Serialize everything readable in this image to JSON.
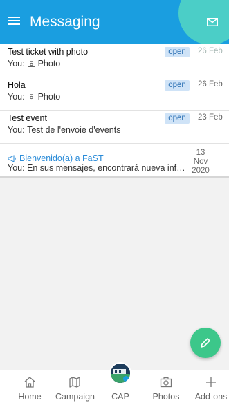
{
  "header": {
    "title": "Messaging"
  },
  "messages": [
    {
      "subject": "Test ticket with photo",
      "preview_prefix": "You:",
      "preview_text": "Photo",
      "status": "open",
      "date": "26 Feb"
    },
    {
      "subject": "Hola",
      "preview_prefix": "You:",
      "preview_text": "Photo",
      "status": "open",
      "date": "26 Feb"
    },
    {
      "subject": "Test event",
      "preview_prefix": "You:",
      "preview_text": "Test de l'envoie d'events",
      "status": "open",
      "date": "23 Feb"
    }
  ],
  "announcement": {
    "subject": "Bienvenido(a) a FaST",
    "preview": "You: En sus mensajes, encontrará nueva información",
    "date_line1": "13 Nov",
    "date_line2": "2020"
  },
  "nav": {
    "home": "Home",
    "campaign": "Campaign",
    "cap": "CAP",
    "photos": "Photos",
    "addons": "Add-ons"
  },
  "colors": {
    "header": "#1a9ee0",
    "accent": "#4fd3c4",
    "fab": "#3cc78a",
    "badge_bg": "#cfe3f7"
  }
}
